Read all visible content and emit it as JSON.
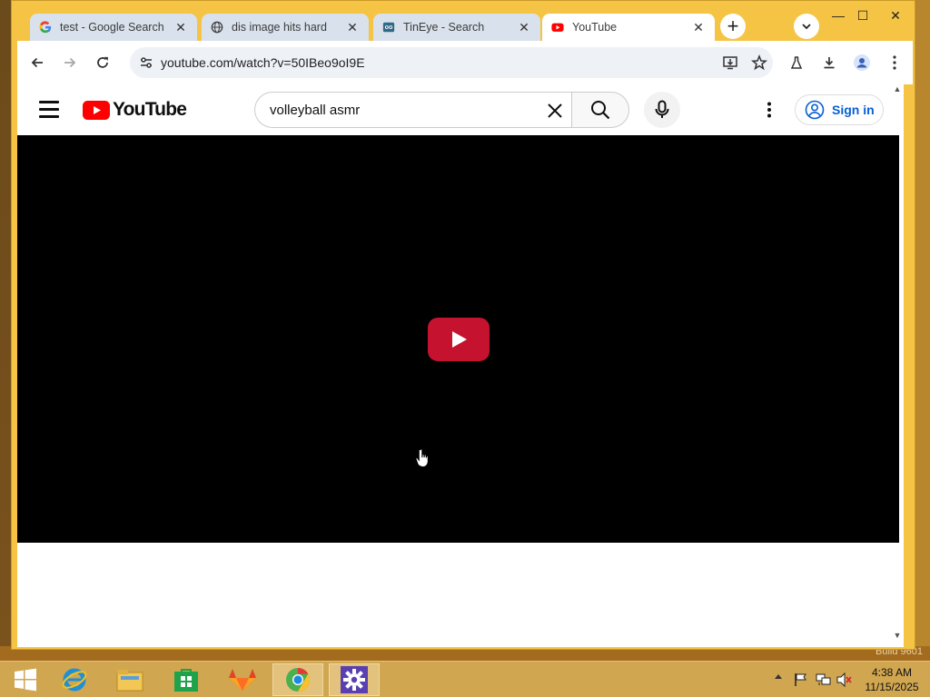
{
  "browser": {
    "tabs": [
      {
        "title": "test - Google Search",
        "favicon": "google-g-icon",
        "active": false
      },
      {
        "title": "dis image hits hard",
        "favicon": "globe-icon",
        "active": false
      },
      {
        "title": "TinEye - Search",
        "favicon": "tineye-icon",
        "active": false
      },
      {
        "title": "YouTube",
        "favicon": "youtube-icon",
        "active": true
      }
    ],
    "new_tab_label": "+",
    "tab_close_glyph": "✕",
    "window_controls": {
      "minimize": "—",
      "maximize": "☐",
      "close": "✕"
    },
    "address": "youtube.com/watch?v=50IBeo9oI9E"
  },
  "youtube": {
    "logo_text": "YouTube",
    "search_query": "volleyball asmr",
    "sign_in_label": "Sign in",
    "accent_color": "#ff0000",
    "play_button_color": "#c4122f"
  },
  "taskbar": {
    "apps": [
      "windows-start-icon",
      "internet-explorer-icon",
      "file-explorer-icon",
      "store-icon",
      "gitlab-fox-icon",
      "chrome-icon",
      "settings-gear-icon"
    ],
    "clock_time": "4:38 AM",
    "clock_date": "11/15/2025"
  },
  "desktop": {
    "watermark": "Build 9601"
  }
}
